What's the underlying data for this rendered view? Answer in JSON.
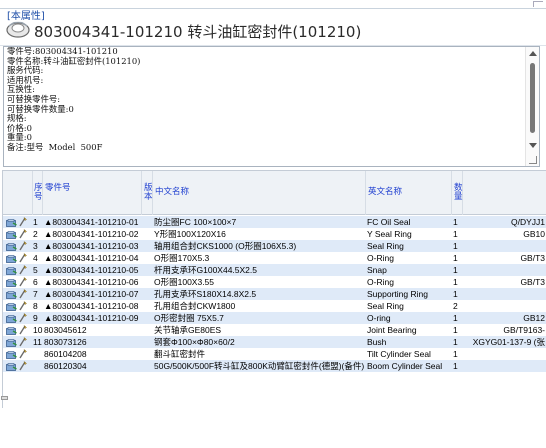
{
  "header": {
    "badge": "[本属性]",
    "title": "803004341-101210 转斗油缸密封件(101210)"
  },
  "info": {
    "lines": [
      "零件号:803004341-101210",
      "零件名称:转斗油缸密封件(101210)",
      "服务代码:",
      "适用机号:",
      "互换性:",
      "可替换零件号:",
      "可替换零件数量:0",
      "规格:",
      "价格:0",
      "重量:0",
      "备注:型号  Model  500F"
    ]
  },
  "table": {
    "headers": {
      "seq": "序号",
      "part_no": "零件号",
      "version": "版本",
      "cn_name": "中文名称",
      "en_name": "英文名称",
      "qty": "数量"
    },
    "rows": [
      {
        "seq": "1",
        "part_no": "▲803004341-101210-01",
        "cn_name": "防尘圈FC 100×100×7",
        "en_name": "FC Oil Seal",
        "qty": "1",
        "spec": "Q/DYJJ1"
      },
      {
        "seq": "2",
        "part_no": "▲803004341-101210-02",
        "cn_name": "Y形圈100X120X16",
        "en_name": "Y Seal Ring",
        "qty": "1",
        "spec": "GB10"
      },
      {
        "seq": "3",
        "part_no": "▲803004341-101210-03",
        "cn_name": "轴用组合封CKS1000  (O形圈106X5.3)",
        "en_name": "Seal Ring",
        "qty": "1",
        "spec": ""
      },
      {
        "seq": "4",
        "part_no": "▲803004341-101210-04",
        "cn_name": "O形圈170X5.3",
        "en_name": "O-Ring",
        "qty": "1",
        "spec": "GB/T3"
      },
      {
        "seq": "5",
        "part_no": "▲803004341-101210-05",
        "cn_name": "杆用支承环G100X44.5X2.5",
        "en_name": "Snap",
        "qty": "1",
        "spec": ""
      },
      {
        "seq": "6",
        "part_no": "▲803004341-101210-06",
        "cn_name": "O形圈100X3.55",
        "en_name": "O-Ring",
        "qty": "1",
        "spec": "GB/T3"
      },
      {
        "seq": "7",
        "part_no": "▲803004341-101210-07",
        "cn_name": "孔用支承环S180X14.8X2.5",
        "en_name": "Supporting Ring",
        "qty": "1",
        "spec": ""
      },
      {
        "seq": "8",
        "part_no": "▲803004341-101210-08",
        "cn_name": "孔用组合封CKW1800",
        "en_name": "Seal Ring",
        "qty": "2",
        "spec": ""
      },
      {
        "seq": "9",
        "part_no": "▲803004341-101210-09",
        "cn_name": "O形密封圈 75X5.7",
        "en_name": "O-ring",
        "qty": "1",
        "spec": "GB12"
      },
      {
        "seq": "10",
        "part_no": "803045612",
        "cn_name": "关节轴承GE80ES",
        "en_name": "Joint Bearing",
        "qty": "1",
        "spec": "GB/T9163-"
      },
      {
        "seq": "11",
        "part_no": "803073126",
        "cn_name": "钢套Φ100×Φ80×60/2",
        "en_name": "Bush",
        "qty": "1",
        "spec": "XGYG01-137-9 (张"
      },
      {
        "seq": "",
        "part_no": "860104208",
        "cn_name": "翻斗缸密封件",
        "en_name": "Tilt Cylinder Seal",
        "qty": "1",
        "spec": ""
      },
      {
        "seq": "",
        "part_no": "860120304",
        "cn_name": "50G/500K/500F转斗缸及800K动臂缸密封件(德盟)(备件)",
        "en_name": "Boom Cylinder Seal",
        "qty": "1",
        "spec": ""
      }
    ]
  },
  "colors": {
    "link_blue": "#1f3fd0",
    "row_highlight": "#dfeaf8",
    "header_bg": "#eef2f6"
  }
}
